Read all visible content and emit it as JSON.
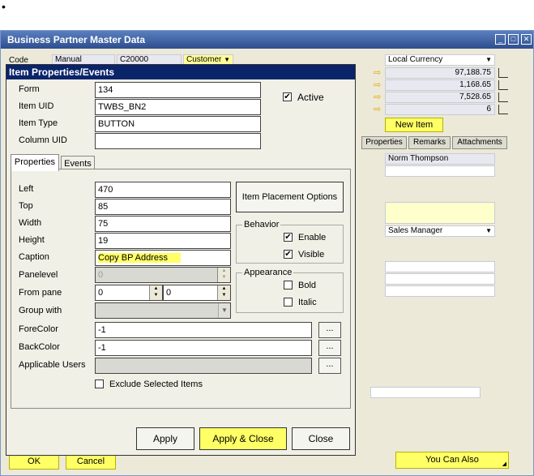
{
  "bullet": "•",
  "bp_window": {
    "title": "Business Partner Master Data",
    "code_label": "Code",
    "code_series": "Manual",
    "code_value": "C20000",
    "type_value": "Customer",
    "currency": "Local Currency",
    "amounts": [
      "97,188.75",
      "1,168.65",
      "7,528.65",
      "6"
    ],
    "new_item_label": "New Item",
    "tabs": [
      "Properties",
      "Remarks",
      "Attachments"
    ],
    "contact_name": "Norm Thompson",
    "position": "Sales Manager",
    "ok_label": "OK",
    "cancel_label": "Cancel",
    "you_can_also_label": "You Can Also"
  },
  "dialog": {
    "title": "Item Properties/Events",
    "form_label": "Form",
    "form_value": "134",
    "item_uid_label": "Item UID",
    "item_uid_value": "TWBS_BN2",
    "item_type_label": "Item Type",
    "item_type_value": "BUTTON",
    "column_uid_label": "Column UID",
    "column_uid_value": "",
    "active_label": "Active",
    "active_checked": true,
    "tabs": [
      "Properties",
      "Events"
    ],
    "left_label": "Left",
    "left_value": "470",
    "top_label": "Top",
    "top_value": "85",
    "width_label": "Width",
    "width_value": "75",
    "height_label": "Height",
    "height_value": "19",
    "caption_label": "Caption",
    "caption_value": "Copy BP Address",
    "panelevel_label": "Panelevel",
    "panelevel_value": "0",
    "from_pane_label": "From pane",
    "from_pane_value": "0",
    "to_pane_value": "0",
    "group_with_label": "Group with",
    "forecolor_label": "ForeColor",
    "forecolor_value": "-1",
    "backcolor_label": "BackColor",
    "backcolor_value": "-1",
    "applicable_users_label": "Applicable Users",
    "exclude_selected_label": "Exclude Selected Items",
    "placement_options_label": "Item Placement Options",
    "behavior_label": "Behavior",
    "enable_label": "Enable",
    "visible_label": "Visible",
    "appearance_label": "Appearance",
    "bold_label": "Bold",
    "italic_label": "Italic",
    "dots_label": "...",
    "apply_label": "Apply",
    "apply_close_label": "Apply & Close",
    "close_label": "Close"
  },
  "colors": {
    "title_bar": "#0a246a",
    "highlight": "#ffff66",
    "window_bg": "#ece9d8"
  }
}
